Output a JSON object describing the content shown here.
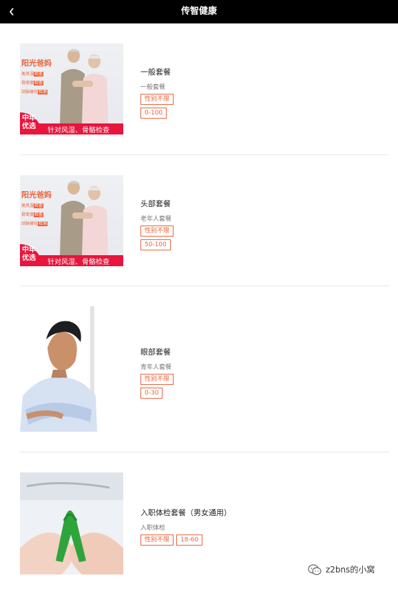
{
  "header": {
    "title": "传智健康",
    "back_icon": "chevron-left-icon"
  },
  "packages": [
    {
      "name": "一般套餐",
      "subtitle": "一般套餐",
      "tags": [
        "性别不限",
        "0-100"
      ],
      "image": {
        "brand": "阳光爸妈",
        "items": [
          [
            "类风湿",
            "检查"
          ],
          [
            "骨密度",
            "检查"
          ],
          [
            "动脉硬化",
            "检测"
          ]
        ],
        "corner": "中年优选",
        "banner": "针对风湿、骨骼检查"
      }
    },
    {
      "name": "头部套餐",
      "subtitle": "老年人套餐",
      "tags": [
        "性别不限",
        "50-100"
      ],
      "image": {
        "brand": "阳光爸妈",
        "items": [
          [
            "类风湿",
            "检查"
          ],
          [
            "骨密度",
            "检查"
          ],
          [
            "动脉硬化",
            "检测"
          ]
        ],
        "corner": "中年优选",
        "banner": "针对风湿、骨骼检查"
      }
    },
    {
      "name": "眼部套餐",
      "subtitle": "青年人套餐",
      "tags": [
        "性别不限",
        "0-30"
      ]
    },
    {
      "name": "入职体检套餐（男女通用）",
      "subtitle": "入职体检",
      "tags": [
        "性别不限",
        "18-60"
      ]
    }
  ],
  "watermark": {
    "text": "z2bns的小窝",
    "icon": "wechat-icon"
  },
  "colors": {
    "accent": "#e9623a",
    "banner_red": "#e8153c",
    "topbar": "#000000"
  }
}
